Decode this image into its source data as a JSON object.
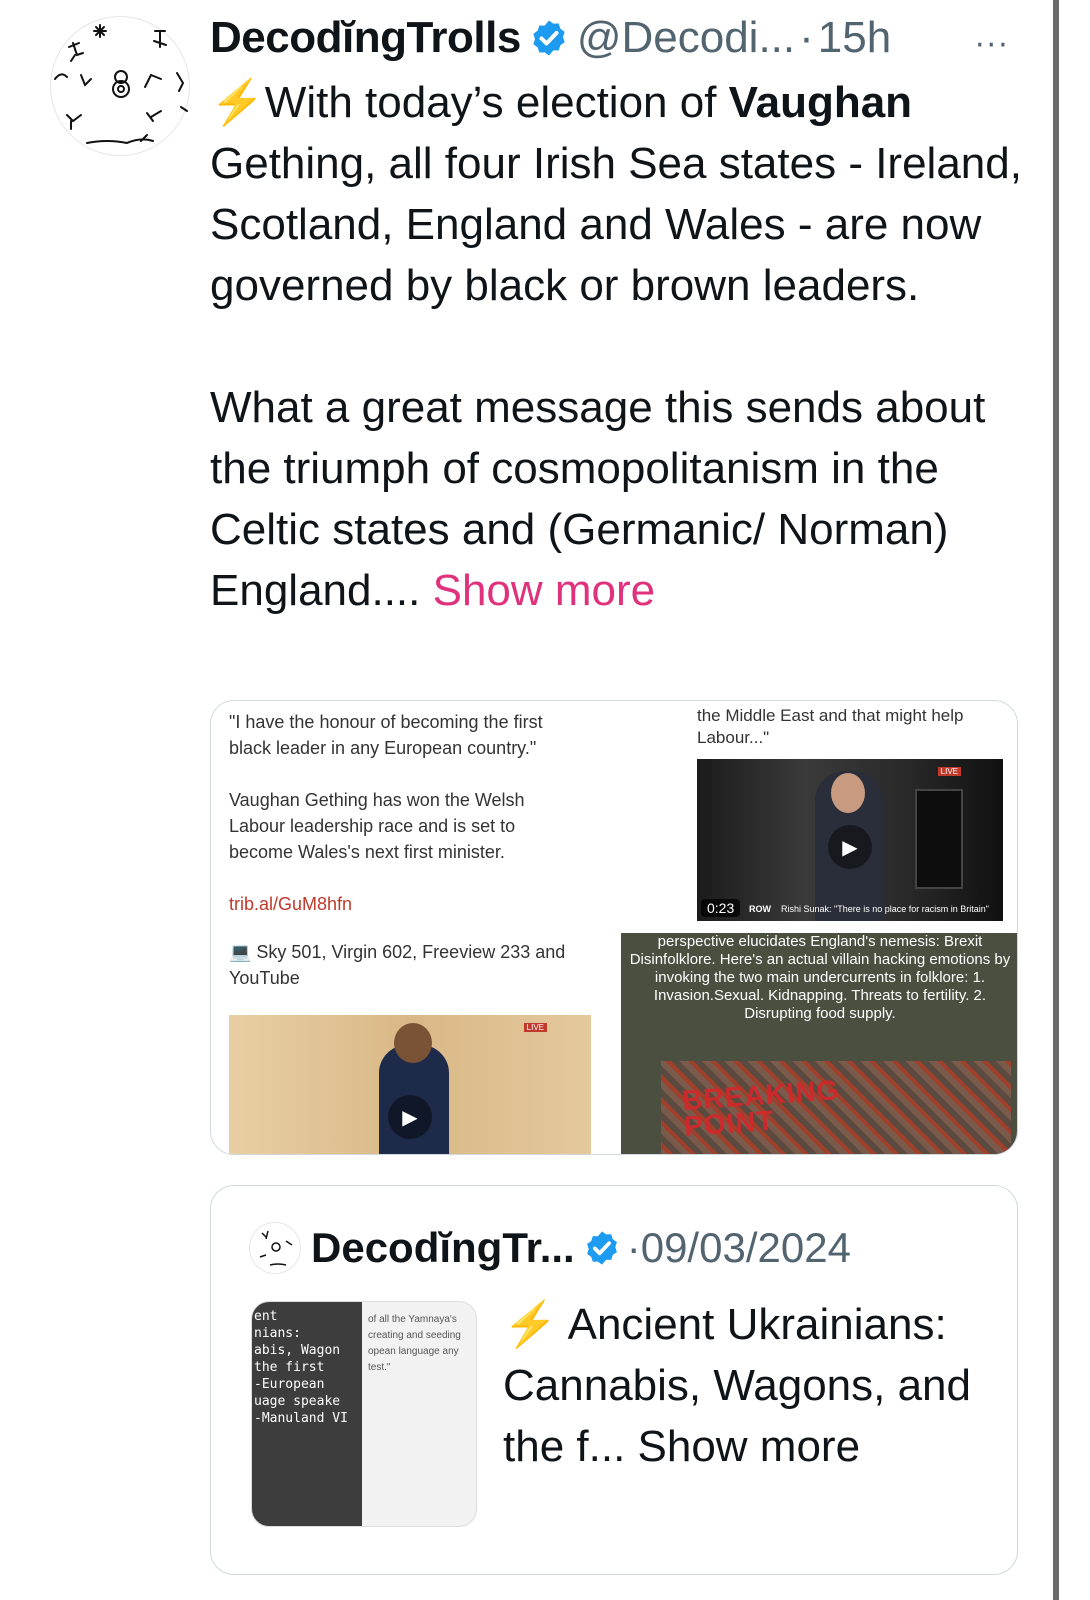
{
  "tweet": {
    "author_name": "DecodĭngTrolls",
    "handle": "@Decodi...",
    "separator": "·",
    "time": "15h",
    "more": "···",
    "bolt": "⚡",
    "text_line1_prefix": "With today’s election of ",
    "text_bold": "Vaughan",
    "text_rest": "Gething, all four Irish Sea states - Ireland, Scotland, England and Wales - are now governed by black or brown leaders.",
    "text_para2": "What a great message this sends about the triumph of cosmopolitanism in the Celtic states and (Germanic/ Norman) England.... ",
    "show_more": "Show more"
  },
  "media": {
    "tile1": {
      "quote": "\"I have the honour of becoming the first black leader in any European country.\"",
      "body": "Vaughan Gething has won the Welsh Labour leadership race and is set to become Wales's next first minister.",
      "link": "trib.al/GuM8hfn"
    },
    "tile2": {
      "text": "the Middle East and that might help Labour...\"",
      "timecode": "0:23",
      "strip_tag": "ROW",
      "strip_caption": "Rishi Sunak: \"There is no place for racism in Britain\"",
      "live": "LIVE"
    },
    "tile3": {
      "text": "💻 Sky 501, Virgin 602, Freeview 233 and YouTube",
      "live": "LIVE"
    },
    "tile4": {
      "text": "perspective elucidates England's nemesis: Brexit Disinfolklore. Here's an actual villain hacking emotions by invoking the two main undercurrents in folklore: 1. Invasion.Sexual. Kidnapping. Threats to fertility. 2. Disrupting food supply.",
      "poster": "BREAKING POINT"
    }
  },
  "quote": {
    "author_name": "DecodĭngTr...",
    "separator": "·",
    "date": "09/03/2024",
    "bolt": "⚡",
    "text": " Ancient Ukrainians: Cannabis, Wagons, and the f... ",
    "show_more": "Show more",
    "thumb_left": "ent\nnians:\nabis, Wagon\nthe first\n-European\nuage speake\n-Manuland VI",
    "thumb_right": "of all the Yamnaya's creating and seeding opean language any test.\""
  },
  "colors": {
    "accent_link": "#e0317c",
    "verified": "#1d9bf0",
    "muted": "#536471"
  }
}
